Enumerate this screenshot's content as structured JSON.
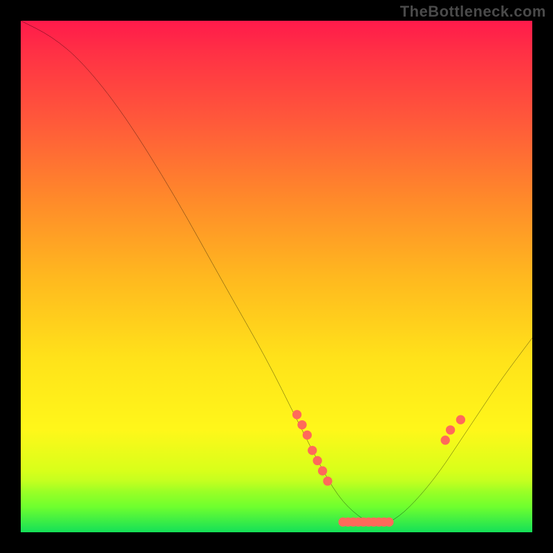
{
  "watermark": "TheBottleneck.com",
  "chart_data": {
    "type": "line",
    "title": "",
    "xlabel": "",
    "ylabel": "",
    "xlim": [
      0,
      100
    ],
    "ylim": [
      0,
      100
    ],
    "grid": false,
    "legend": false,
    "series": [
      {
        "name": "bottleneck-curve",
        "x": [
          0,
          6,
          12,
          20,
          30,
          40,
          48,
          54,
          58,
          62,
          66,
          70,
          74,
          78,
          82,
          86,
          90,
          94,
          100
        ],
        "y": [
          100,
          97,
          92,
          82,
          66,
          48,
          34,
          22,
          14,
          7,
          3,
          1,
          3,
          7,
          12,
          18,
          24,
          30,
          38
        ]
      }
    ],
    "markers": {
      "name": "highlighted-points",
      "color": "#ff6a5a",
      "points": [
        {
          "x": 54,
          "y": 23
        },
        {
          "x": 55,
          "y": 21
        },
        {
          "x": 56,
          "y": 19
        },
        {
          "x": 57,
          "y": 16
        },
        {
          "x": 58,
          "y": 14
        },
        {
          "x": 59,
          "y": 12
        },
        {
          "x": 60,
          "y": 10
        },
        {
          "x": 63,
          "y": 2
        },
        {
          "x": 64,
          "y": 2
        },
        {
          "x": 65,
          "y": 2
        },
        {
          "x": 66,
          "y": 2
        },
        {
          "x": 67,
          "y": 2
        },
        {
          "x": 68,
          "y": 2
        },
        {
          "x": 69,
          "y": 2
        },
        {
          "x": 70,
          "y": 2
        },
        {
          "x": 71,
          "y": 2
        },
        {
          "x": 72,
          "y": 2
        },
        {
          "x": 83,
          "y": 18
        },
        {
          "x": 84,
          "y": 20
        },
        {
          "x": 86,
          "y": 22
        }
      ]
    },
    "background_gradient": {
      "top": "#ff1a4b",
      "mid": "#ffe21a",
      "bottom": "#14e058"
    }
  }
}
